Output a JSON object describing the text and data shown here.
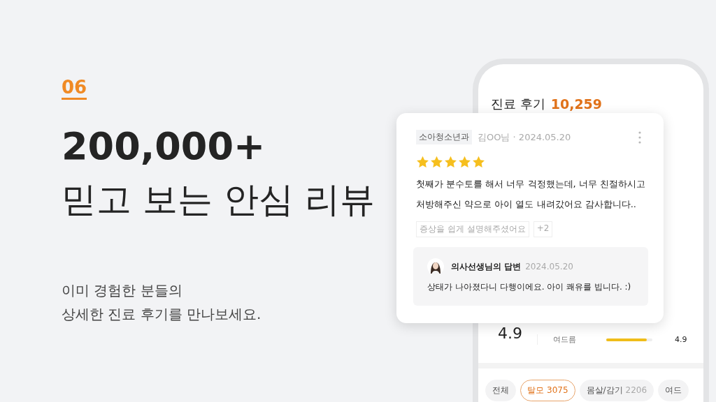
{
  "section_number": "06",
  "headline": "200,000+",
  "subheadline": "믿고 보는 안심 리뷰",
  "description": [
    "이미 경험한 분들의",
    "상세한 진료 후기를 만나보세요."
  ],
  "phone": {
    "title": "진료 후기",
    "count": "10,259",
    "overall_rating": "4.9",
    "rating_rows": [
      {
        "label": "여드름",
        "level": 0.88,
        "value": "4.9"
      }
    ],
    "filters": [
      {
        "label": "전체",
        "selected": false
      },
      {
        "label": "탈모",
        "count": "3075",
        "selected": true
      },
      {
        "label": "몸살/감기",
        "count": "2206",
        "selected": false
      },
      {
        "label": "여드",
        "selected": false
      }
    ]
  },
  "review": {
    "department": "소아청소년과",
    "author": "김OO님 · 2024.05.20",
    "stars": 5,
    "text": [
      "첫째가 분수토를 해서 너무 걱정했는데, 너무 친절하시고",
      "처방해주신 약으로 아이 열도 내려갔어요 감사합니다.."
    ],
    "tags": [
      "증상을 쉽게 설명해주셨어요",
      "+2"
    ],
    "reply": {
      "title": "의사선생님의 답변",
      "date": "2024.05.20",
      "text": "상태가 나아졌다니 다행이에요. 아이 쾌유를 빕니다. :)"
    }
  }
}
